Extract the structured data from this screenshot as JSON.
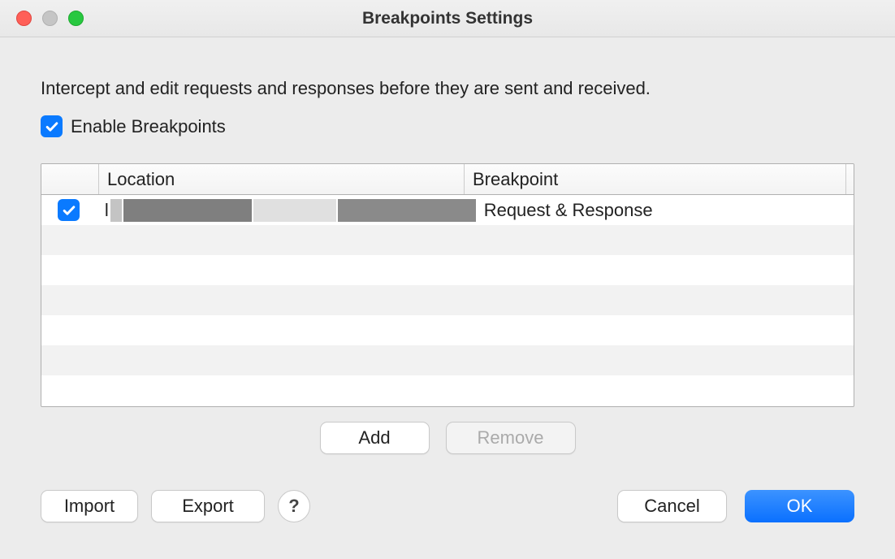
{
  "window": {
    "title": "Breakpoints Settings"
  },
  "description": "Intercept and edit requests and responses before they are sent and received.",
  "enable": {
    "label": "Enable Breakpoints",
    "checked": true
  },
  "table": {
    "columns": {
      "location": "Location",
      "breakpoint": "Breakpoint"
    },
    "rows": [
      {
        "checked": true,
        "location": "l",
        "breakpoint": "Request & Response"
      }
    ]
  },
  "buttons": {
    "add": "Add",
    "remove": "Remove",
    "import": "Import",
    "export": "Export",
    "help": "?",
    "cancel": "Cancel",
    "ok": "OK"
  }
}
